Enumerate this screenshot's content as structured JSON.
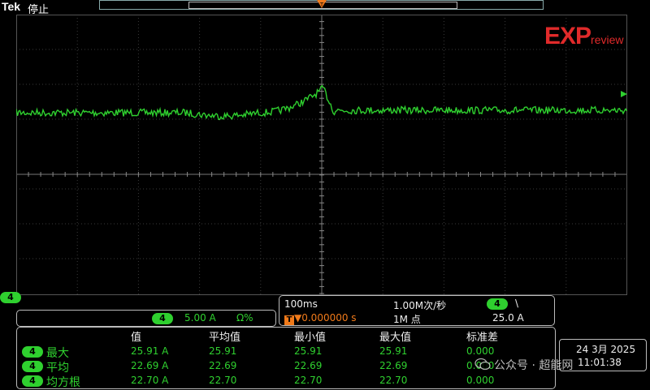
{
  "header": {
    "brand": "Tek",
    "run_state": "停止"
  },
  "logo": {
    "big": "EXP",
    "small": "review",
    "color": "#e02a2a"
  },
  "channel": {
    "id": "4",
    "scale": "5.00 A",
    "coupling": "Ω%",
    "color": "#2fd02f"
  },
  "timebase": {
    "scale": "100ms",
    "trigger_position": "▼0.000000 s",
    "sample_rate": "1.00M次/秒",
    "record_length": "1M 点",
    "trigger_channel": "4",
    "trigger_slope": "\\",
    "trigger_level": "25.0 A",
    "trigger_badge": "T"
  },
  "measurements": {
    "headers": [
      "值",
      "平均值",
      "最小值",
      "最大值",
      "标准差"
    ],
    "rows": [
      {
        "channel": "4",
        "name": "最大",
        "values": [
          "25.91 A",
          "25.91",
          "25.91",
          "25.91",
          "0.000"
        ]
      },
      {
        "channel": "4",
        "name": "平均",
        "values": [
          "22.69 A",
          "22.69",
          "22.69",
          "22.69",
          "0.000"
        ]
      },
      {
        "channel": "4",
        "name": "均方根",
        "values": [
          "22.70 A",
          "22.70",
          "22.70",
          "22.70",
          "0.000"
        ]
      }
    ]
  },
  "datetime": {
    "date": "24 3月 2025",
    "time": "11:01:38"
  },
  "watermark": {
    "text": "公众号 · 超能网"
  }
}
